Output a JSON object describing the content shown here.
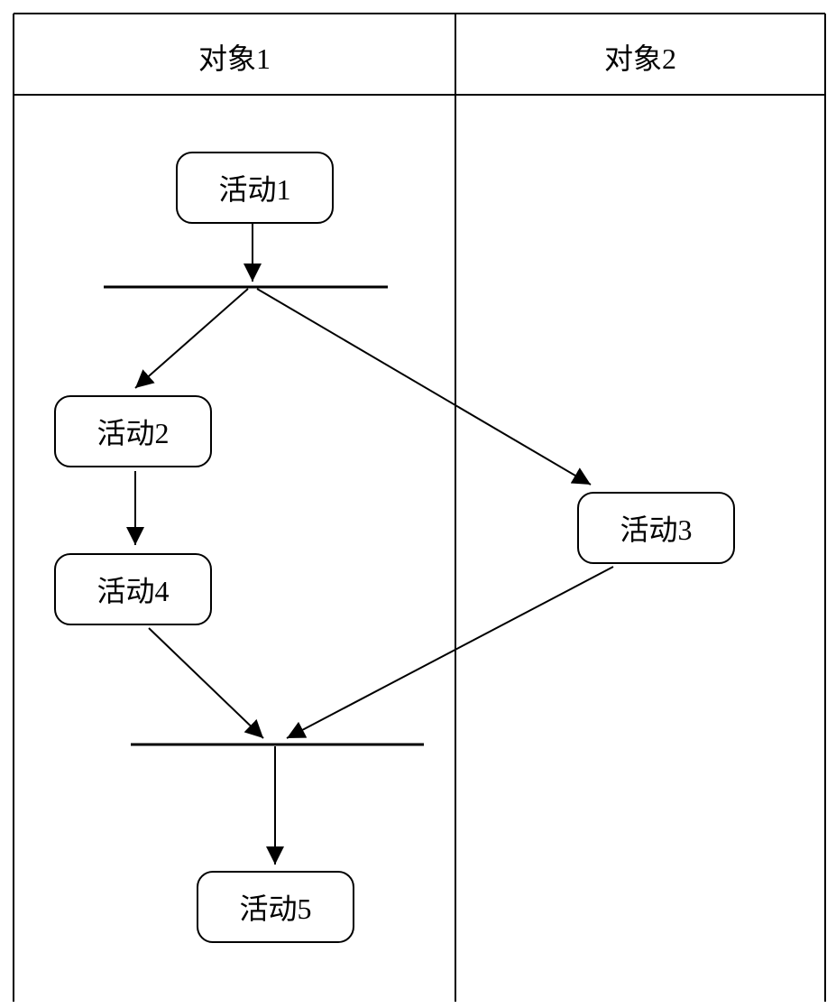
{
  "swimlanes": {
    "lane1": {
      "label": "对象1"
    },
    "lane2": {
      "label": "对象2"
    }
  },
  "activities": {
    "a1": {
      "label": "活动1"
    },
    "a2": {
      "label": "活动2"
    },
    "a3": {
      "label": "活动3"
    },
    "a4": {
      "label": "活动4"
    },
    "a5": {
      "label": "活动5"
    }
  },
  "diagram": {
    "type": "uml-activity-diagram",
    "description": "Activity diagram with two swimlanes showing parallel fork and join",
    "nodes": [
      {
        "id": "a1",
        "lane": "lane1",
        "type": "activity"
      },
      {
        "id": "fork1",
        "lane": "lane1",
        "type": "fork"
      },
      {
        "id": "a2",
        "lane": "lane1",
        "type": "activity"
      },
      {
        "id": "a3",
        "lane": "lane2",
        "type": "activity"
      },
      {
        "id": "a4",
        "lane": "lane1",
        "type": "activity"
      },
      {
        "id": "join1",
        "lane": "lane1",
        "type": "join"
      },
      {
        "id": "a5",
        "lane": "lane1",
        "type": "activity"
      }
    ],
    "edges": [
      {
        "from": "a1",
        "to": "fork1"
      },
      {
        "from": "fork1",
        "to": "a2"
      },
      {
        "from": "fork1",
        "to": "a3"
      },
      {
        "from": "a2",
        "to": "a4"
      },
      {
        "from": "a4",
        "to": "join1"
      },
      {
        "from": "a3",
        "to": "join1"
      },
      {
        "from": "join1",
        "to": "a5"
      }
    ]
  }
}
